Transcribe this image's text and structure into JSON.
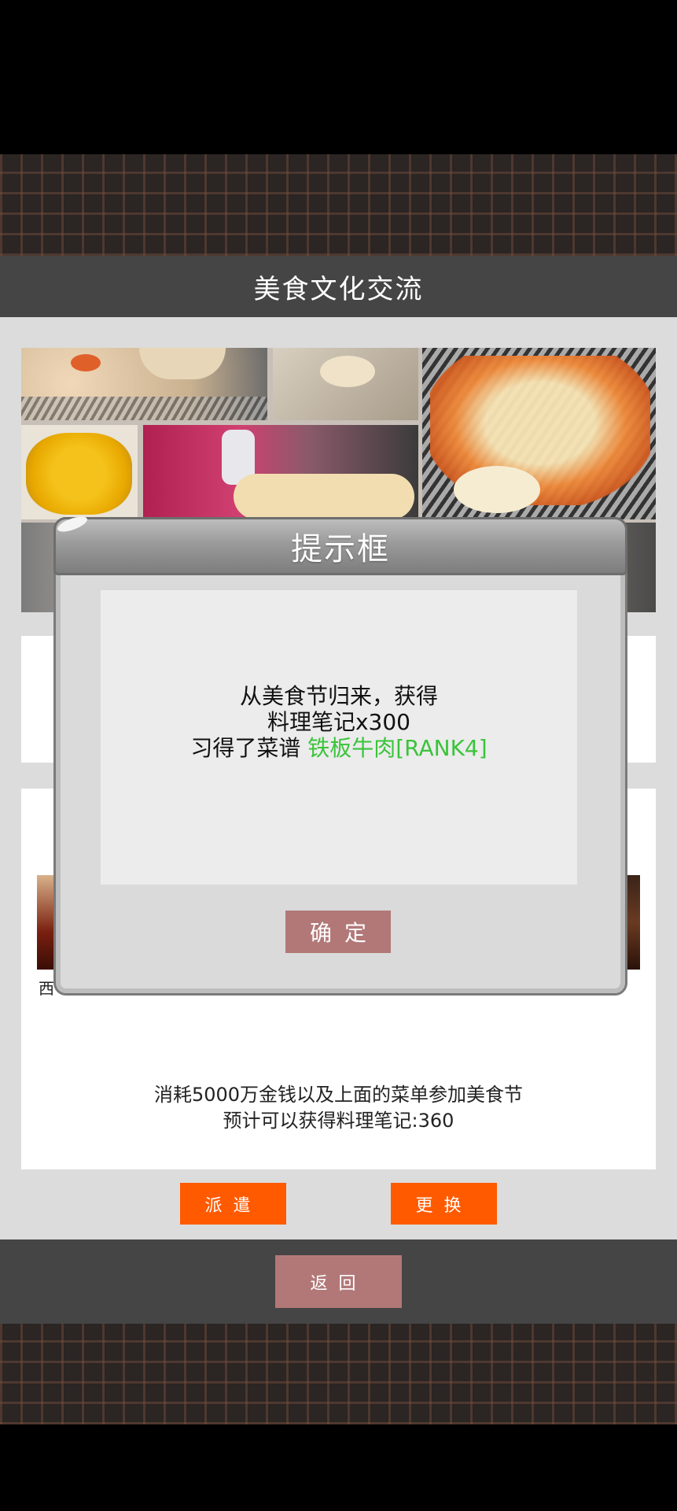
{
  "header": {
    "title": "美食文化交流"
  },
  "dialog": {
    "title": "提示框",
    "line1": "从美食节归来，获得",
    "line2": "料理笔记x300",
    "line3_prefix": "习得了菜谱 ",
    "line3_highlight": "铁板牛肉[RANK4]",
    "confirm_label": "确定"
  },
  "dishes": {
    "left_label_partial": "西"
  },
  "info": {
    "line1": "消耗5000万金钱以及上面的菜单参加美食节",
    "line2": "预计可以获得料理笔记:360"
  },
  "actions": {
    "dispatch_label": "派遣",
    "change_label": "更换",
    "back_label": "返回"
  },
  "colors": {
    "accent_orange": "#ff5a00",
    "button_rose": "#b27878",
    "highlight_green": "#3ac43a",
    "bar_gray": "#454545"
  }
}
